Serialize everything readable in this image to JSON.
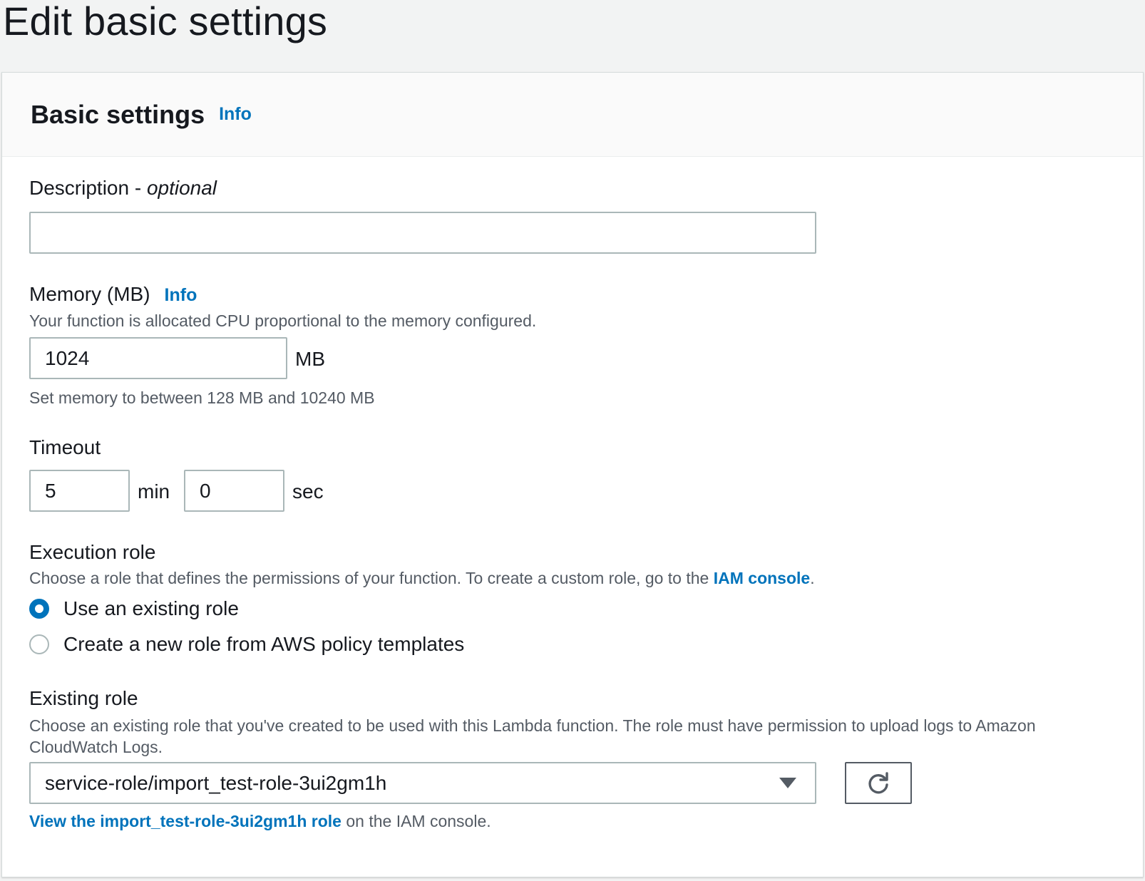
{
  "page": {
    "title": "Edit basic settings"
  },
  "panel": {
    "title": "Basic settings",
    "info": "Info"
  },
  "description": {
    "label": "Description - ",
    "label_optional": "optional",
    "value": "",
    "placeholder": ""
  },
  "memory": {
    "label": "Memory (MB)",
    "info": "Info",
    "hint": "Your function is allocated CPU proportional to the memory configured.",
    "value": "1024",
    "unit": "MB",
    "constraint": "Set memory to between 128 MB and 10240 MB"
  },
  "timeout": {
    "label": "Timeout",
    "min_value": "5",
    "min_unit": "min",
    "sec_value": "0",
    "sec_unit": "sec"
  },
  "execution_role": {
    "label": "Execution role",
    "hint_prefix": "Choose a role that defines the permissions of your function. To create a custom role, go to the ",
    "hint_link": "IAM console",
    "hint_suffix": ".",
    "options": [
      {
        "label": "Use an existing role",
        "checked": true
      },
      {
        "label": "Create a new role from AWS policy templates",
        "checked": false
      }
    ]
  },
  "existing_role": {
    "label": "Existing role",
    "hint": "Choose an existing role that you've created to be used with this Lambda function. The role must have permission to upload logs to Amazon CloudWatch Logs.",
    "selected": "service-role/import_test-role-3ui2gm1h",
    "view_link": "View the import_test-role-3ui2gm1h role",
    "view_suffix": " on the IAM console."
  },
  "colors": {
    "accent": "#0073bb",
    "text": "#16191f",
    "muted": "#545b64",
    "border": "#aab7b8"
  },
  "icons": {
    "refresh": "refresh-icon",
    "dropdown": "caret-down-icon"
  }
}
